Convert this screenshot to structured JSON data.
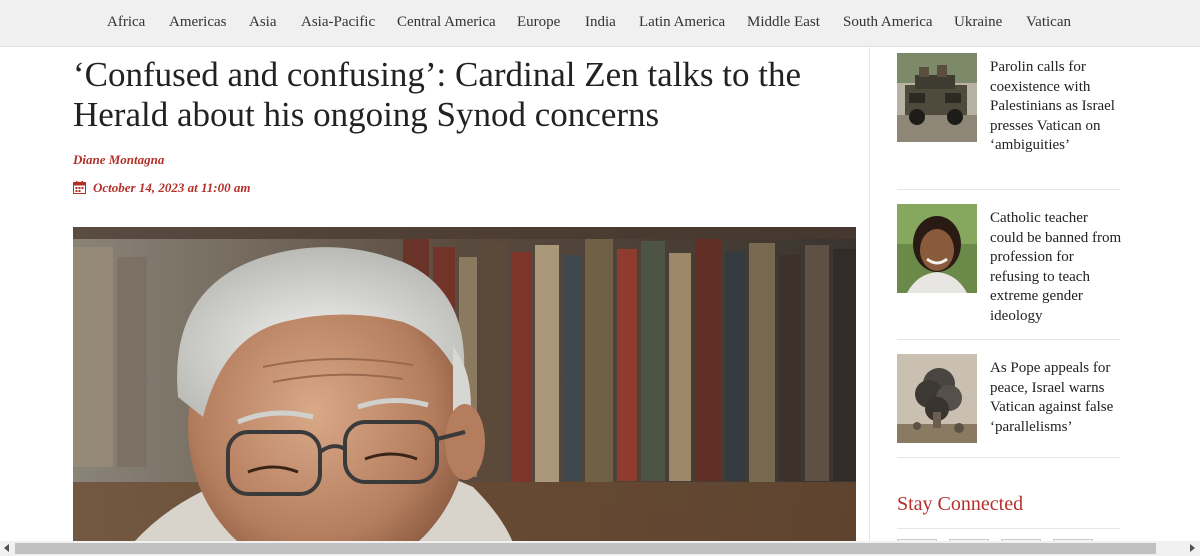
{
  "nav": {
    "items": [
      "Africa",
      "Americas",
      "Asia",
      "Asia-Pacific",
      "Central America",
      "Europe",
      "India",
      "Latin America",
      "Middle East",
      "South America",
      "Ukraine",
      "Vatican"
    ]
  },
  "article": {
    "headline": "‘Confused and confusing’: Cardinal Zen talks to the Herald about his ongoing Synod concerns",
    "author": "Diane Montagna",
    "date": "October 14, 2023 at 11:00 am"
  },
  "sidebar": {
    "items": [
      {
        "title": "Parolin calls for coexistence with Palestinians as Israel presses Vatican on ‘ambiguities’"
      },
      {
        "title": "Catholic teacher could be banned from profession for refusing to teach extreme gender ideology"
      },
      {
        "title": "As Pope appeals for peace, Israel warns Vatican against false ‘parallelisms’"
      }
    ],
    "stay_connected": "Stay Connected"
  },
  "colors": {
    "accent": "#b5302a",
    "nav_bg": "#f0f0f0",
    "text": "#222222"
  }
}
